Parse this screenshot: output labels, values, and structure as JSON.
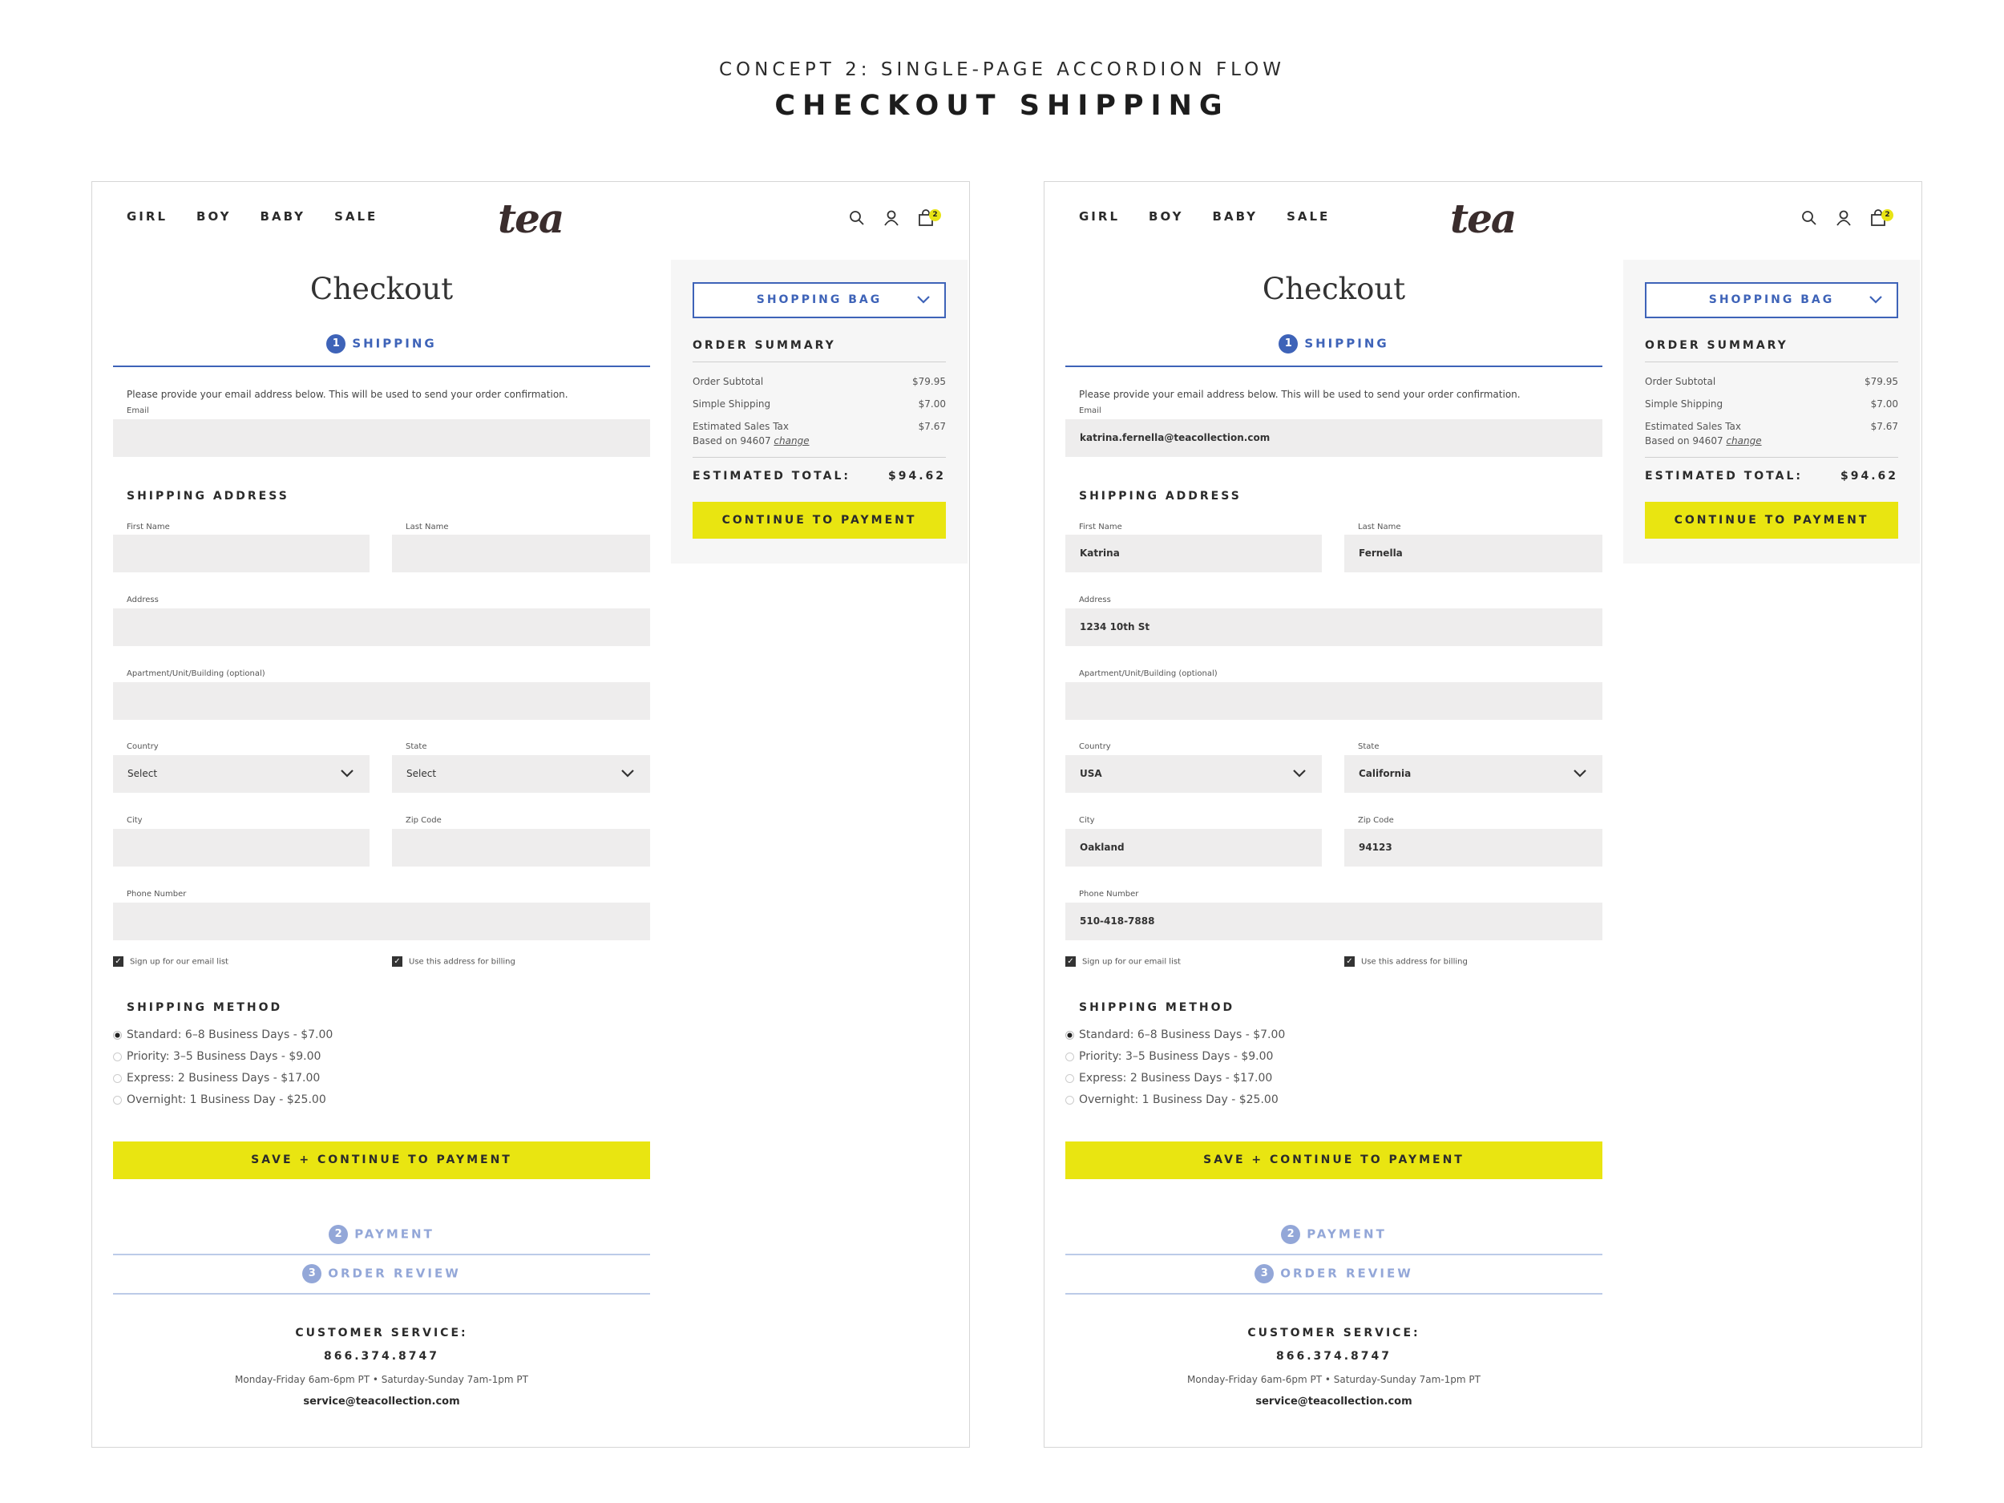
{
  "header": {
    "concept": "CONCEPT 2: SINGLE-PAGE ACCORDION FLOW",
    "title": "CHECKOUT SHIPPING"
  },
  "colors": {
    "accent_blue": "#3e63b8",
    "muted_blue": "#93a7d8",
    "cta_yellow": "#e9e511",
    "field_bg": "#eeeded"
  },
  "nav": {
    "items": [
      "GIRL",
      "BOY",
      "BABY",
      "SALE"
    ],
    "logo": "tea",
    "icons": [
      "search-icon",
      "user-icon",
      "bag-icon"
    ],
    "bag_count": "2"
  },
  "checkout": {
    "heading": "Checkout",
    "step1": {
      "num": "1",
      "label": "SHIPPING"
    },
    "step2": {
      "num": "2",
      "label": "PAYMENT"
    },
    "step3": {
      "num": "3",
      "label": "ORDER REVIEW"
    },
    "intro": "Please provide your email address below. This will be used to send your order confirmation.",
    "labels": {
      "email": "Email",
      "first_name": "First Name",
      "last_name": "Last Name",
      "address": "Address",
      "apt": "Apartment/Unit/Building (optional)",
      "country": "Country",
      "state": "State",
      "city": "City",
      "zip": "Zip Code",
      "phone": "Phone Number"
    },
    "shipping_address_heading": "SHIPPING ADDRESS",
    "checkbox_email": "Sign up for our email list",
    "checkbox_billing": "Use this address for billing",
    "shipping_method_heading": "SHIPPING METHOD",
    "shipping_options": [
      "Standard: 6–8 Business Days - $7.00",
      "Priority: 3–5 Business Days - $9.00",
      "Express: 2 Business Days - $17.00",
      "Overnight: 1 Business Day - $25.00"
    ],
    "selected_option": "Standard: 6–8 Business Days - $7.00",
    "save_button": "SAVE + CONTINUE TO PAYMENT"
  },
  "empty_form": {
    "email": "",
    "first_name": "",
    "last_name": "",
    "address": "",
    "apt": "",
    "country": "Select",
    "state": "Select",
    "city": "",
    "zip": "",
    "phone": ""
  },
  "filled_form": {
    "email": "katrina.fernella@teacollection.com",
    "first_name": "Katrina",
    "last_name": "Fernella",
    "address": "1234 10th St",
    "apt": "",
    "country": "USA",
    "state": "California",
    "city": "Oakland",
    "zip": "94123",
    "phone": "510-418-7888"
  },
  "summary": {
    "bag_button": "SHOPPING BAG",
    "heading": "ORDER SUMMARY",
    "subtotal_label": "Order Subtotal",
    "subtotal": "$79.95",
    "shipping_label": "Simple Shipping",
    "shipping": "$7.00",
    "tax_label": "Estimated Sales Tax",
    "tax": "$7.67",
    "tax_note": "Based on 94607",
    "tax_change": "change",
    "total_label": "ESTIMATED TOTAL:",
    "total": "$94.62",
    "continue_button": "CONTINUE TO PAYMENT"
  },
  "customer_service": {
    "heading": "CUSTOMER SERVICE:",
    "phone": "866.374.8747",
    "hours": "Monday-Friday 6am-6pm PT • Saturday-Sunday 7am-1pm PT",
    "email": "service@teacollection.com"
  }
}
